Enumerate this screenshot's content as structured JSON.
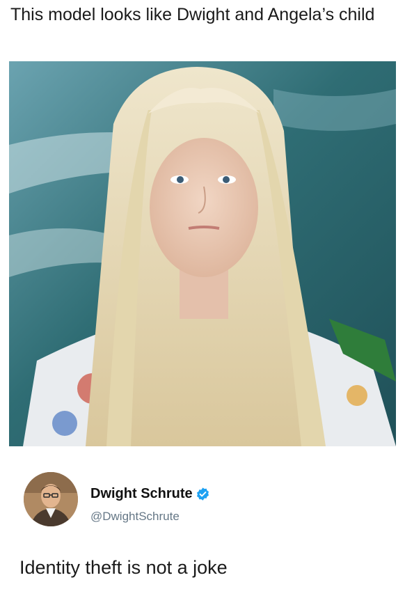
{
  "post": {
    "caption": "This model looks like Dwight and Angela’s child"
  },
  "photo": {
    "icon": "portrait-photo",
    "colors": {
      "background": "#2f6d74",
      "hair": "#e8dcb8",
      "skin": "#e9c9b3",
      "collar": "#2f7d3a"
    }
  },
  "tweet": {
    "display_name": "Dwight Schrute",
    "verified": true,
    "handle": "@DwightSchrute",
    "text": "Identity theft is not a joke",
    "colors": {
      "verified": "#1da1f2",
      "handle": "#657786"
    }
  }
}
